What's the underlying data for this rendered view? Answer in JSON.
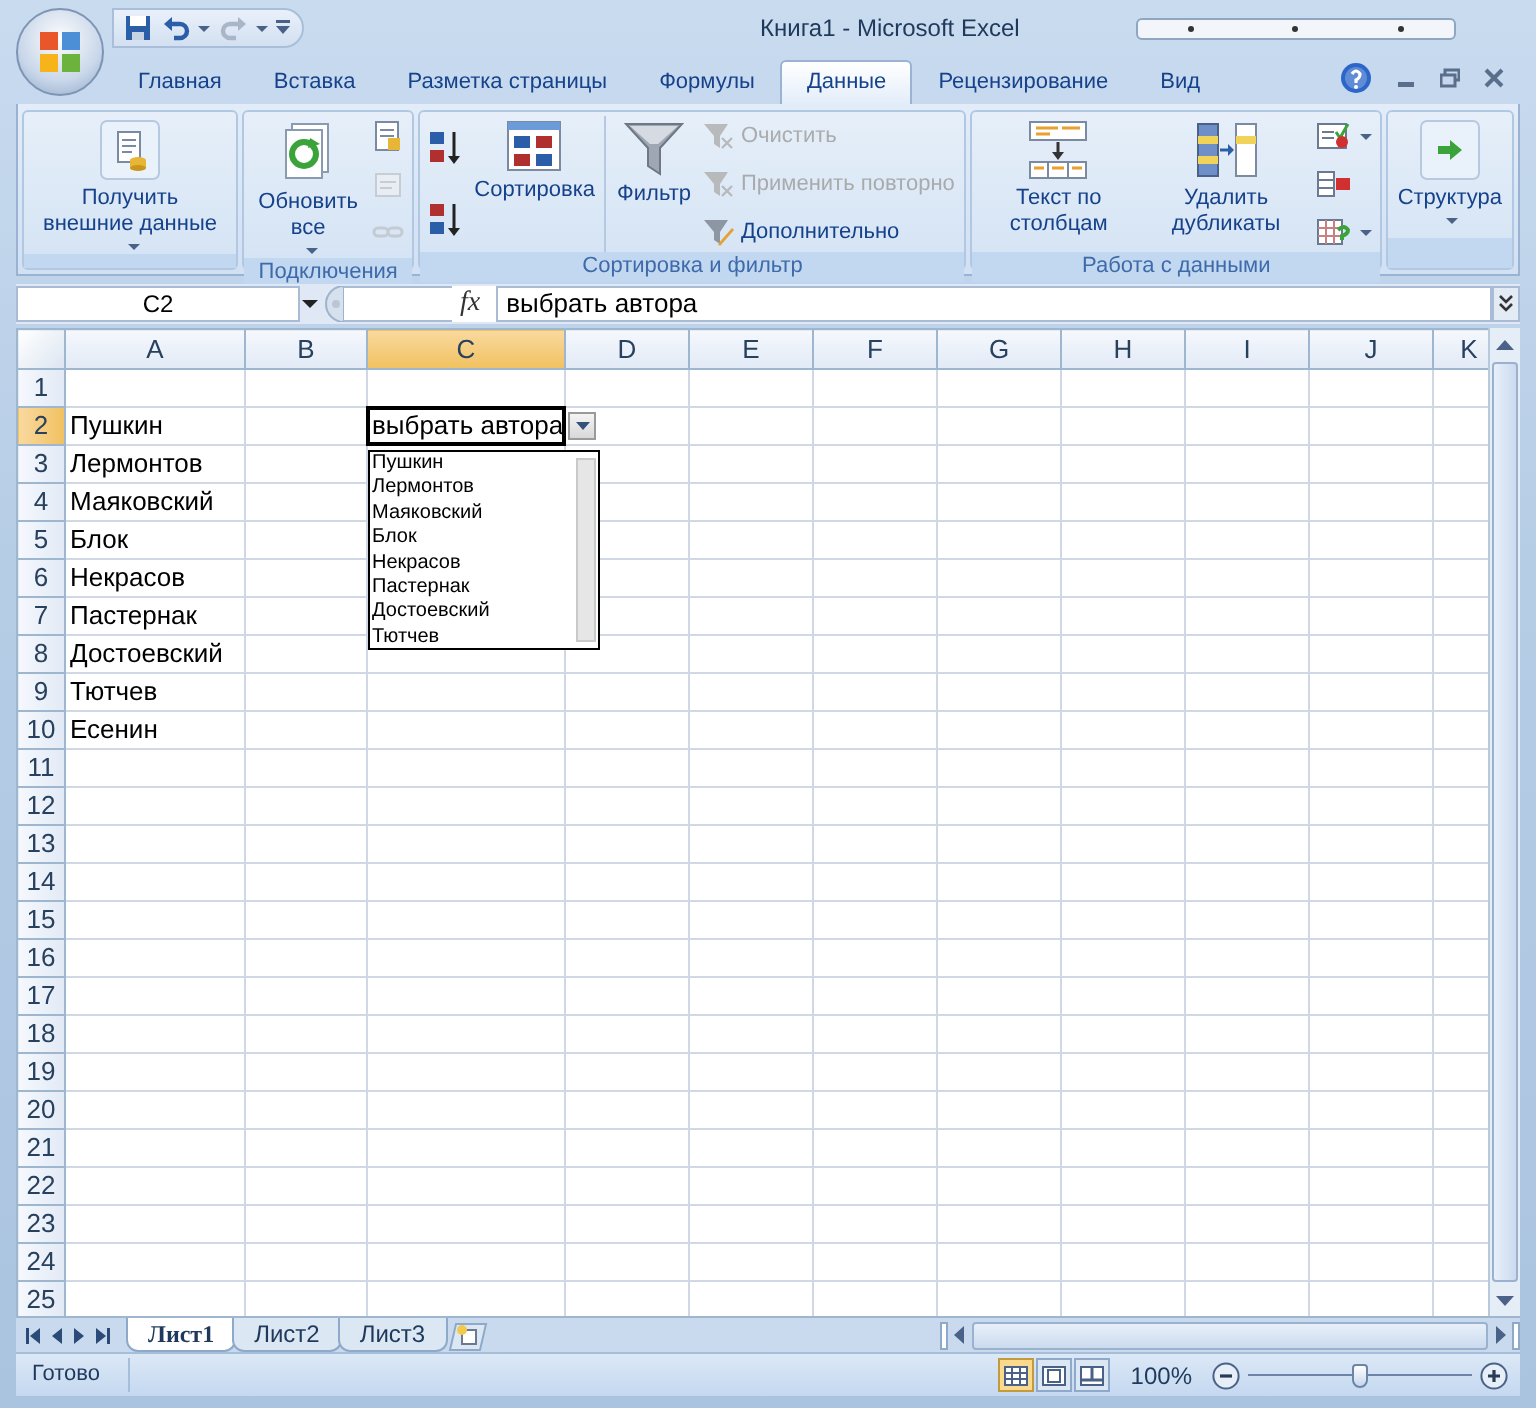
{
  "window": {
    "title": "Книга1 - Microsoft Excel"
  },
  "quick_access": [
    {
      "kind": "save",
      "disabled": false
    },
    {
      "kind": "undo",
      "disabled": false
    },
    {
      "kind": "redo",
      "disabled": true
    }
  ],
  "tabs": [
    {
      "label": "Главная",
      "selected": false
    },
    {
      "label": "Вставка",
      "selected": false
    },
    {
      "label": "Разметка страницы",
      "selected": false
    },
    {
      "label": "Формулы",
      "selected": false
    },
    {
      "label": "Данные",
      "selected": true
    },
    {
      "label": "Рецензирование",
      "selected": false
    },
    {
      "label": "Вид",
      "selected": false
    }
  ],
  "ribbon_groups": [
    {
      "columns": [
        [
          {
            "kind": "large",
            "label": "Получить внешние данные",
            "dropdown": true,
            "disabled": false
          }
        ]
      ]
    },
    {
      "label": "Подключения",
      "columns": [
        [
          {
            "kind": "large",
            "label": "Обновить все",
            "dropdown": true,
            "disabled": false
          }
        ],
        [
          {
            "kind": "icon",
            "dropdown": false,
            "disabled": false
          },
          {
            "kind": "icon",
            "dropdown": false,
            "disabled": true
          },
          {
            "kind": "icon",
            "dropdown": false,
            "disabled": true
          }
        ]
      ]
    },
    {
      "label": "Сортировка и фильтр",
      "columns": [
        [
          {
            "kind": "icon",
            "dropdown": false,
            "disabled": false
          },
          {
            "kind": "icon",
            "dropdown": false,
            "disabled": false
          }
        ],
        [
          {
            "kind": "large",
            "label": "Сортировка",
            "dropdown": false,
            "disabled": false
          }
        ],
        [
          {
            "kind": "large",
            "label": "Фильтр",
            "dropdown": false,
            "disabled": false
          }
        ],
        [
          {
            "kind": "small",
            "label": "Очистить",
            "dropdown": false,
            "disabled": true
          },
          {
            "kind": "small",
            "label": "Применить повторно",
            "dropdown": false,
            "disabled": true
          },
          {
            "kind": "small",
            "label": "Дополнительно",
            "dropdown": false,
            "disabled": false
          }
        ]
      ]
    },
    {
      "label": "Работа с данными",
      "columns": [
        [
          {
            "kind": "large",
            "label": "Текст по столбцам",
            "dropdown": false,
            "disabled": false
          }
        ],
        [
          {
            "kind": "large",
            "label": "Удалить дубликаты",
            "dropdown": false,
            "disabled": false
          }
        ],
        [
          {
            "kind": "icon",
            "dropdown": true,
            "disabled": false
          },
          {
            "kind": "icon",
            "dropdown": false,
            "disabled": false
          },
          {
            "kind": "icon",
            "dropdown": true,
            "disabled": false
          }
        ]
      ]
    },
    {
      "columns": [
        [
          {
            "kind": "large",
            "label": "Структура",
            "dropdown": true,
            "disabled": false
          }
        ]
      ]
    }
  ],
  "formula_bar": {
    "name_box": "C2",
    "function_button": "fx",
    "value": "выбрать автора"
  },
  "columns": [
    {
      "label": "A",
      "selected": false
    },
    {
      "label": "B",
      "selected": false
    },
    {
      "label": "C",
      "selected": true
    },
    {
      "label": "D",
      "selected": false
    },
    {
      "label": "E",
      "selected": false
    },
    {
      "label": "F",
      "selected": false
    },
    {
      "label": "G",
      "selected": false
    },
    {
      "label": "H",
      "selected": false
    },
    {
      "label": "I",
      "selected": false
    },
    {
      "label": "J",
      "selected": false
    },
    {
      "label": "K",
      "selected": false
    }
  ],
  "rows": [
    {
      "header": "1",
      "selected": false,
      "cells": []
    },
    {
      "header": "2",
      "selected": true,
      "cells": [
        "Пушкин"
      ]
    },
    {
      "header": "3",
      "selected": false,
      "cells": [
        "Лермонтов"
      ]
    },
    {
      "header": "4",
      "selected": false,
      "cells": [
        "Маяковский"
      ]
    },
    {
      "header": "5",
      "selected": false,
      "cells": [
        "Блок"
      ]
    },
    {
      "header": "6",
      "selected": false,
      "cells": [
        "Некрасов"
      ]
    },
    {
      "header": "7",
      "selected": false,
      "cells": [
        "Пастернак"
      ]
    },
    {
      "header": "8",
      "selected": false,
      "cells": [
        "Достоевский"
      ]
    },
    {
      "header": "9",
      "selected": false,
      "cells": [
        "Тютчев"
      ]
    },
    {
      "header": "10",
      "selected": false,
      "cells": [
        "Есенин"
      ]
    },
    {
      "header": "11",
      "selected": false
    },
    {
      "header": "12",
      "selected": false
    },
    {
      "header": "13",
      "selected": false
    },
    {
      "header": "14",
      "selected": false
    },
    {
      "header": "15",
      "selected": false
    },
    {
      "header": "16",
      "selected": false
    },
    {
      "header": "17",
      "selected": false
    },
    {
      "header": "18",
      "selected": false
    },
    {
      "header": "19",
      "selected": false
    },
    {
      "header": "20",
      "selected": false
    },
    {
      "header": "21",
      "selected": false
    },
    {
      "header": "22",
      "selected": false
    },
    {
      "header": "23",
      "selected": false
    },
    {
      "header": "24",
      "selected": false
    },
    {
      "header": "25",
      "selected": false
    }
  ],
  "data_validation": {
    "value": "выбрать автора",
    "options": [
      "Пушкин",
      "Лермонтов",
      "Маяковский",
      "Блок",
      "Некрасов",
      "Пастернак",
      "Достоевский",
      "Тютчев"
    ]
  },
  "sheet_tabs": [
    {
      "label": "Лист1",
      "selected": true
    },
    {
      "label": "Лист2",
      "selected": false
    },
    {
      "label": "Лист3",
      "selected": false
    }
  ],
  "status_bar": {
    "status": "Готово",
    "views": [
      {
        "selected": true
      },
      {
        "selected": false
      },
      {
        "selected": false
      }
    ],
    "zoom": "100%",
    "zoom_slider": {
      "level": 0.5
    }
  }
}
